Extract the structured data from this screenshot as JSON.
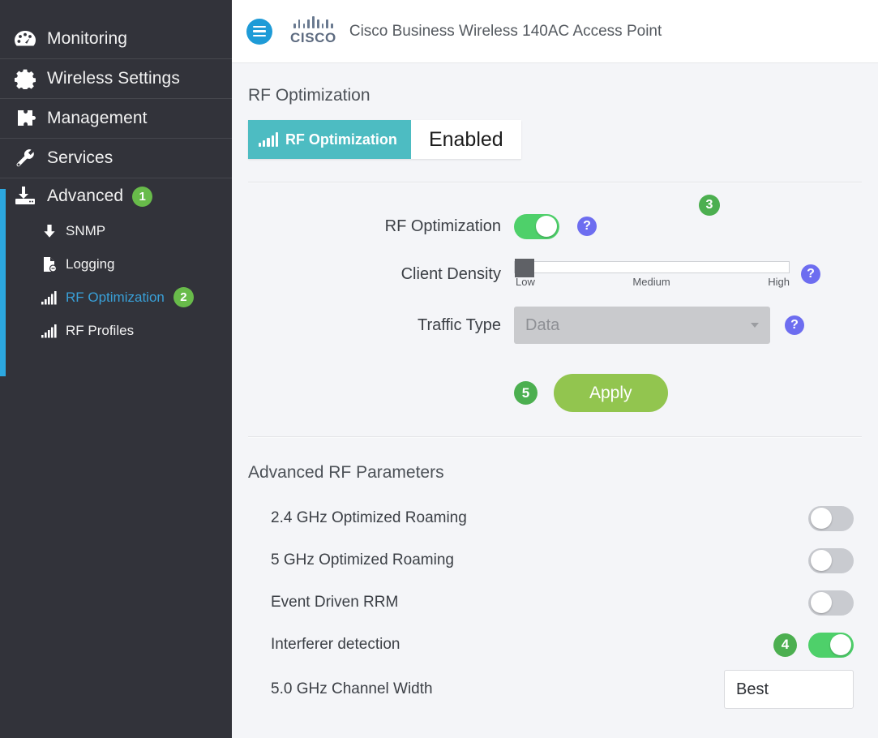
{
  "header": {
    "menu_icon": "hamburger-icon",
    "brand": "CISCO",
    "product_title": "Cisco Business Wireless 140AC Access Point"
  },
  "sidebar": {
    "items": [
      {
        "label": "Monitoring",
        "icon": "dashboard-icon"
      },
      {
        "label": "Wireless Settings",
        "icon": "gear-icon"
      },
      {
        "label": "Management",
        "icon": "puzzle-icon"
      },
      {
        "label": "Services",
        "icon": "wrench-icon"
      },
      {
        "label": "Advanced",
        "icon": "download-icon",
        "badge": "1"
      }
    ],
    "sub_items": [
      {
        "label": "SNMP",
        "icon": "down-arrow-icon",
        "active": false,
        "badge": null
      },
      {
        "label": "Logging",
        "icon": "document-icon",
        "active": false,
        "badge": null
      },
      {
        "label": "RF Optimization",
        "icon": "signal-bars-icon",
        "active": true,
        "badge": "2"
      },
      {
        "label": "RF Profiles",
        "icon": "signal-bars-icon",
        "active": false,
        "badge": null
      }
    ]
  },
  "page": {
    "title": "RF Optimization"
  },
  "kpi": {
    "label": "RF Optimization",
    "value": "Enabled",
    "icon": "signal-bars-icon",
    "color": "#4dbcc2"
  },
  "form": {
    "rf_optimization": {
      "label": "RF Optimization",
      "toggle_state": "on",
      "badge": "3",
      "help": "?"
    },
    "client_density": {
      "label": "Client Density",
      "value": "Low",
      "ticks": [
        "Low",
        "Medium",
        "High"
      ],
      "help": "?"
    },
    "traffic_type": {
      "label": "Traffic Type",
      "value": "Data",
      "disabled": true,
      "help": "?"
    },
    "apply": {
      "label": "Apply",
      "badge": "5",
      "color": "#92c54f"
    }
  },
  "advanced": {
    "title": "Advanced RF Parameters",
    "rows": [
      {
        "label": "2.4 GHz Optimized Roaming",
        "control": "toggle",
        "state": "off",
        "badge": null,
        "value": null
      },
      {
        "label": "5 GHz Optimized Roaming",
        "control": "toggle",
        "state": "off",
        "badge": null,
        "value": null
      },
      {
        "label": "Event Driven RRM",
        "control": "toggle",
        "state": "off",
        "badge": null,
        "value": null
      },
      {
        "label": "Interferer detection",
        "control": "toggle",
        "state": "on",
        "badge": "4",
        "value": null
      },
      {
        "label": "5.0 GHz Channel Width",
        "control": "select",
        "state": null,
        "badge": null,
        "value": "Best"
      }
    ]
  },
  "colors": {
    "sidebar_bg": "#32333a",
    "accent_blue": "#2ca8e0",
    "teal": "#4dbcc2",
    "green_toggle": "#4ed06a",
    "green_badge": "#4caf50",
    "apply_green": "#92c54f",
    "help_purple": "#6d6df0",
    "link_blue": "#39a0d8"
  }
}
